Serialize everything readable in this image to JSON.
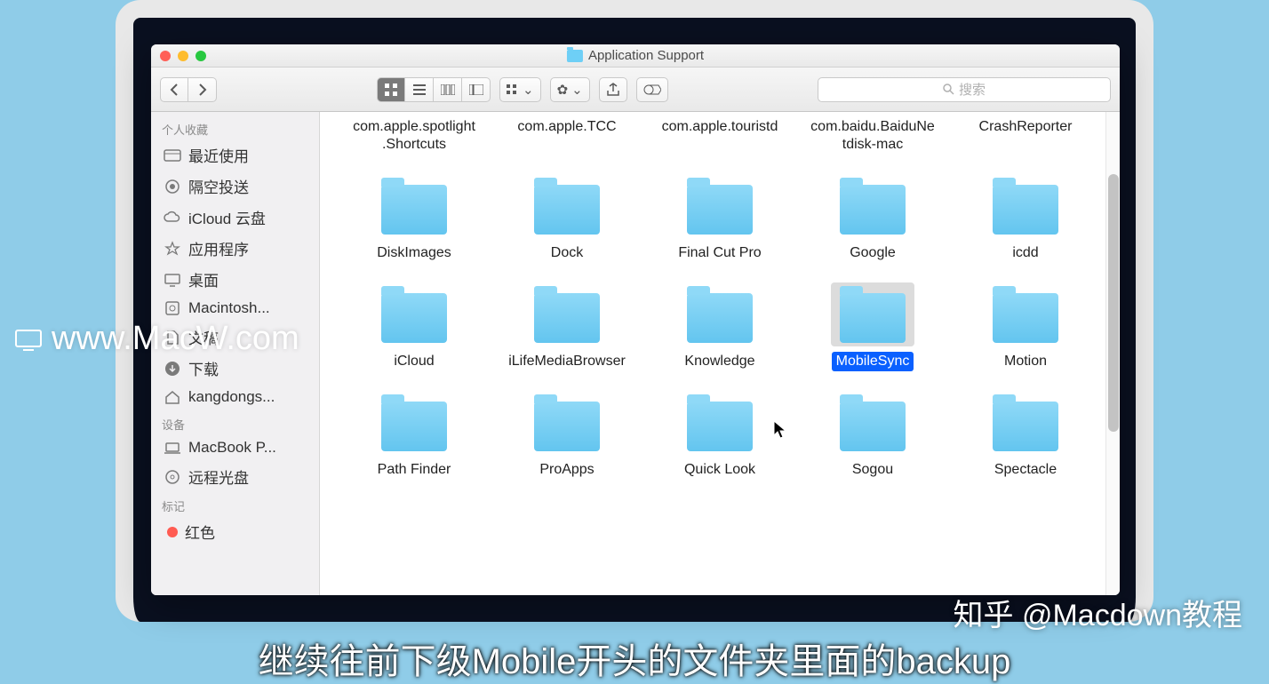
{
  "window": {
    "title": "Application Support"
  },
  "toolbar": {
    "search_placeholder": "搜索"
  },
  "sidebar": {
    "favorites_heading": "个人收藏",
    "devices_heading": "设备",
    "tags_heading": "标记",
    "favorites": [
      {
        "label": "最近使用",
        "icon": "clock-icon"
      },
      {
        "label": "隔空投送",
        "icon": "airdrop-icon"
      },
      {
        "label": "iCloud 云盘",
        "icon": "cloud-icon"
      },
      {
        "label": "应用程序",
        "icon": "applications-icon"
      },
      {
        "label": "桌面",
        "icon": "desktop-icon"
      },
      {
        "label": "Macintosh...",
        "icon": "hdd-icon"
      },
      {
        "label": "文稿",
        "icon": "documents-icon"
      },
      {
        "label": "下载",
        "icon": "downloads-icon"
      },
      {
        "label": "kangdongs...",
        "icon": "home-icon"
      }
    ],
    "devices": [
      {
        "label": "MacBook P...",
        "icon": "laptop-icon"
      },
      {
        "label": "远程光盘",
        "icon": "disc-icon"
      }
    ],
    "tags": [
      {
        "label": "红色",
        "color": "#ff5b52"
      }
    ]
  },
  "folders_partial_row": [
    "com.apple.spotlight.Shortcuts",
    "com.apple.TCC",
    "com.apple.touristd",
    "com.baidu.BaiduNetdisk-mac",
    "CrashReporter"
  ],
  "folders": [
    "DiskImages",
    "Dock",
    "Final Cut Pro",
    "Google",
    "icdd",
    "iCloud",
    "iLifeMediaBrowser",
    "Knowledge",
    "MobileSync",
    "Motion",
    "Path Finder",
    "ProApps",
    "Quick Look",
    "Sogou",
    "Spectacle"
  ],
  "selected_folder": "MobileSync",
  "watermark": "www.MacW.com",
  "caption": "继续往前下级Mobile开头的文件夹里面的backup",
  "credit": "知乎 @Macdown教程"
}
